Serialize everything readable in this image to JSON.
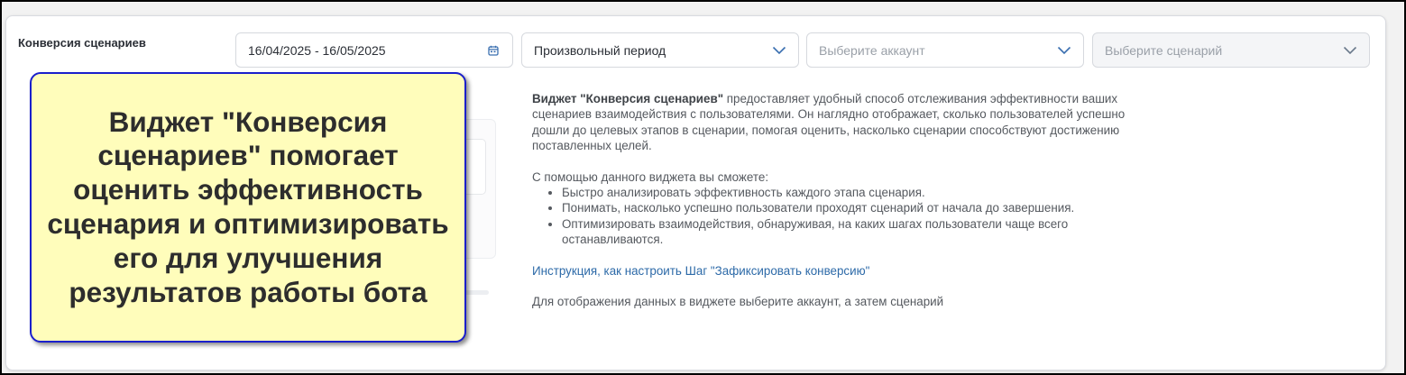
{
  "widget": {
    "title": "Конверсия сценариев"
  },
  "filters": {
    "date_range": "16/04/2025 - 16/05/2025",
    "period": "Произвольный период",
    "account_placeholder": "Выберите аккаунт",
    "scenario_placeholder": "Выберите сценарий"
  },
  "description": {
    "intro_bold": "Виджет \"Конверсия сценариев\"",
    "intro_rest": " предоставляет удобный способ отслеживания эффективности ваших сценариев взаимодействия с пользователями. Он наглядно отображает, сколько пользователей успешно дошли до целевых этапов в сценарии, помогая оценить, насколько сценарии способствуют достижению поставленных целей.",
    "list_intro": "С помощью данного виджета вы сможете:",
    "bullets": [
      "Быстро анализировать эффективность каждого этапа сценария.",
      "Понимать, насколько успешно пользователи проходят сценарий от начала до завершения.",
      "Оптимизировать взаимодействия, обнаруживая, на каких шагах пользователи чаще всего останавливаются."
    ],
    "instruction_link": "Инструкция, как настроить Шаг \"Зафиксировать конверсию\"",
    "hint": "Для отображения данных в виджете выберите аккаунт, а затем сценарий"
  },
  "callout": {
    "text": "Виджет \"Конверсия сценариев\" помогает оценить эффективность сценария и оптимизировать его для улучшения результатов работы бота"
  },
  "icons": {
    "date": "calendar-icon",
    "dropdown": "chevron-down-icon"
  },
  "colors": {
    "callout_bg": "#fffdbb",
    "callout_border": "#1a1fcc",
    "link": "#2d6aa8"
  }
}
